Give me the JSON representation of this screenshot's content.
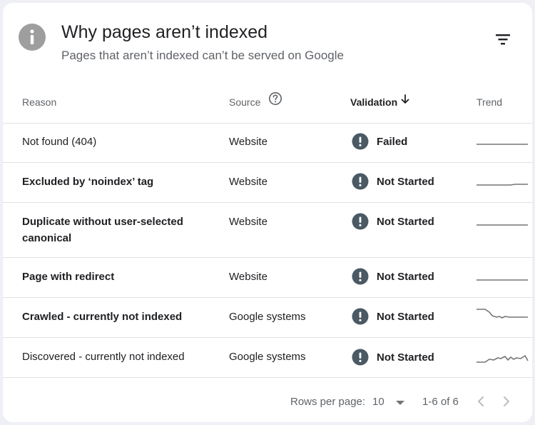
{
  "header": {
    "title": "Why pages aren’t indexed",
    "subtitle": "Pages that aren’t indexed can’t be served on Google",
    "icon": "info-icon",
    "filter_icon": "filter-icon"
  },
  "table": {
    "columns": {
      "reason": "Reason",
      "source": "Source",
      "validation": "Validation",
      "trend": "Trend"
    },
    "rows": [
      {
        "reason": "Not found (404)",
        "source": "Website",
        "validation": "Failed",
        "status_icon": "alert-icon"
      },
      {
        "reason": "Excluded by ‘noindex’ tag",
        "source": "Website",
        "validation": "Not Started",
        "status_icon": "alert-icon"
      },
      {
        "reason": "Duplicate without user-selected canonical",
        "source": "Website",
        "validation": "Not Started",
        "status_icon": "alert-icon"
      },
      {
        "reason": "Page with redirect",
        "source": "Website",
        "validation": "Not Started",
        "status_icon": "alert-icon"
      },
      {
        "reason": "Crawled - currently not indexed",
        "source": "Google systems",
        "validation": "Not Started",
        "status_icon": "alert-icon"
      },
      {
        "reason": "Discovered - currently not indexed",
        "source": "Google systems",
        "validation": "Not Started",
        "status_icon": "alert-icon"
      }
    ]
  },
  "footer": {
    "rows_per_page_label": "Rows per page:",
    "rows_per_page_value": "10",
    "range": "1-6 of 6"
  },
  "colors": {
    "icon_gray": "#9e9e9e",
    "alert_icon": "#4a5963",
    "text": "#202124",
    "muted": "#5f6368",
    "trend_line": "#757575"
  }
}
